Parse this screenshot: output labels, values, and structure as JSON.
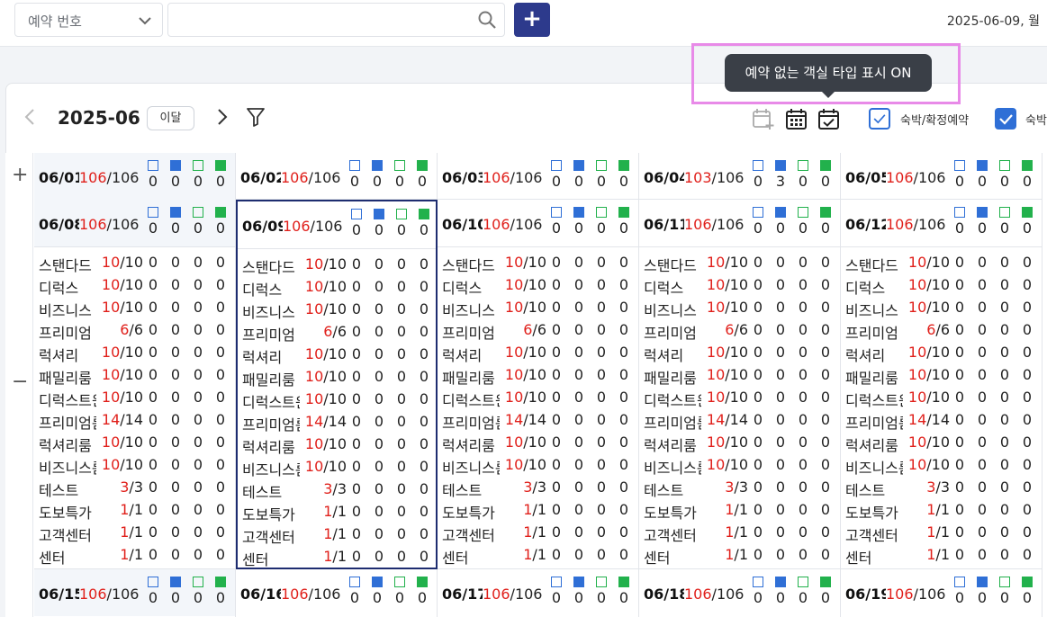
{
  "topbar": {
    "select_label": "예약 번호",
    "search_placeholder": "",
    "add_label": "+",
    "date": "2025-06-09, 월"
  },
  "toolbar": {
    "month": "2025-06",
    "this_month": "이달",
    "checkbox1_label": "숙박/확정예약",
    "checkbox1_checked": false,
    "checkbox2_label": "숙박",
    "checkbox2_checked": true,
    "tooltip": "예약 없는 객실 타입 표시 ON"
  },
  "gutter": {
    "expand": "+",
    "collapse": "−"
  },
  "colors": {
    "accent": "#2d3a8c",
    "red": "#e0201b",
    "blue": "#2f6fd6",
    "green": "#22b14c",
    "highlight": "#e88ae8"
  },
  "row1": [
    {
      "date": "06/01",
      "avail": "106",
      "total": "/106",
      "s": [
        "0",
        "0",
        "0",
        "0"
      ]
    },
    {
      "date": "06/02",
      "avail": "106",
      "total": "/106",
      "s": [
        "0",
        "0",
        "0",
        "0"
      ]
    },
    {
      "date": "06/03",
      "avail": "106",
      "total": "/106",
      "s": [
        "0",
        "0",
        "0",
        "0"
      ]
    },
    {
      "date": "06/04",
      "avail": "103",
      "total": "/106",
      "s": [
        "0",
        "3",
        "0",
        "0"
      ]
    },
    {
      "date": "06/05",
      "avail": "106",
      "total": "/106",
      "s": [
        "0",
        "0",
        "0",
        "0"
      ]
    }
  ],
  "row2": [
    {
      "date": "06/08",
      "avail": "106",
      "total": "/106",
      "s": [
        "0",
        "0",
        "0",
        "0"
      ]
    },
    {
      "date": "06/09",
      "avail": "106",
      "total": "/106",
      "s": [
        "0",
        "0",
        "0",
        "0"
      ]
    },
    {
      "date": "06/10",
      "avail": "106",
      "total": "/106",
      "s": [
        "0",
        "0",
        "0",
        "0"
      ]
    },
    {
      "date": "06/11",
      "avail": "106",
      "total": "/106",
      "s": [
        "0",
        "0",
        "0",
        "0"
      ]
    },
    {
      "date": "06/12",
      "avail": "106",
      "total": "/106",
      "s": [
        "0",
        "0",
        "0",
        "0"
      ]
    }
  ],
  "row3": [
    {
      "date": "06/15",
      "avail": "106",
      "total": "/106",
      "s": [
        "0",
        "0",
        "0",
        "0"
      ]
    },
    {
      "date": "06/16",
      "avail": "106",
      "total": "/106",
      "s": [
        "0",
        "0",
        "0",
        "0"
      ]
    },
    {
      "date": "06/17",
      "avail": "106",
      "total": "/106",
      "s": [
        "0",
        "0",
        "0",
        "0"
      ]
    },
    {
      "date": "06/18",
      "avail": "106",
      "total": "/106",
      "s": [
        "0",
        "0",
        "0",
        "0"
      ]
    },
    {
      "date": "06/19",
      "avail": "106",
      "total": "/106",
      "s": [
        "0",
        "0",
        "0",
        "0"
      ]
    }
  ],
  "rooms": [
    {
      "name": "스탠다드",
      "avail": "10",
      "total": "/10"
    },
    {
      "name": "디럭스",
      "avail": "10",
      "total": "/10"
    },
    {
      "name": "비즈니스",
      "avail": "10",
      "total": "/10"
    },
    {
      "name": "프리미엄",
      "avail": "6",
      "total": "/6"
    },
    {
      "name": "럭셔리",
      "avail": "10",
      "total": "/10"
    },
    {
      "name": "패밀리룸",
      "avail": "10",
      "total": "/10"
    },
    {
      "name": "디럭스트윈",
      "avail": "10",
      "total": "/10"
    },
    {
      "name": "프리미엄룸",
      "avail": "14",
      "total": "/14"
    },
    {
      "name": "럭셔리룸",
      "avail": "10",
      "total": "/10"
    },
    {
      "name": "비즈니스룸",
      "avail": "10",
      "total": "/10"
    },
    {
      "name": "테스트",
      "avail": "3",
      "total": "/3"
    },
    {
      "name": "도보특가",
      "avail": "1",
      "total": "/1"
    },
    {
      "name": "고객센터",
      "avail": "1",
      "total": "/1"
    },
    {
      "name": "센터",
      "avail": "1",
      "total": "/1"
    }
  ],
  "room_stats": [
    "0",
    "0",
    "0",
    "0"
  ]
}
